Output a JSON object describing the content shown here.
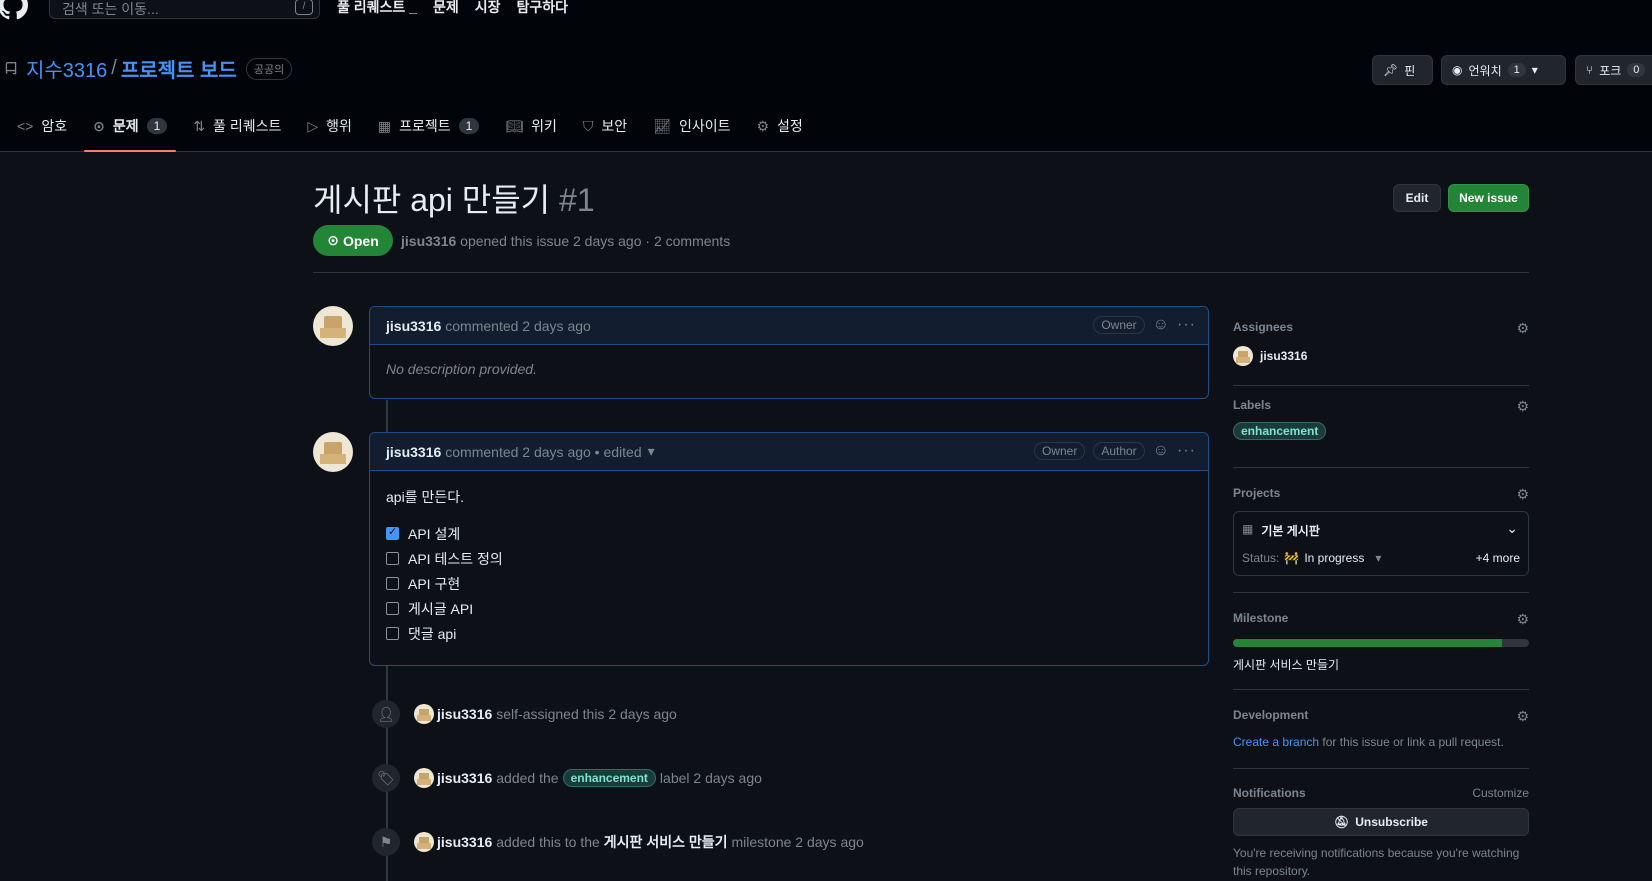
{
  "topbar": {
    "search_placeholder": "검색 또는 이동...",
    "search_key": "/",
    "nav": [
      "풀 리퀘스트 _",
      "문제",
      "시장",
      "탐구하다"
    ]
  },
  "repo": {
    "owner": "지수3316",
    "separator": "/",
    "name": "프로젝트 보드",
    "visibility": "공공의",
    "pin_label": "핀",
    "watch_label": "언워치",
    "watch_count": "1",
    "fork_label": "포크",
    "fork_count": "0"
  },
  "tabs": [
    {
      "label": "암호"
    },
    {
      "label": "문제",
      "count": "1"
    },
    {
      "label": "풀 리퀘스트"
    },
    {
      "label": "행위"
    },
    {
      "label": "프로젝트",
      "count": "1"
    },
    {
      "label": "위키"
    },
    {
      "label": "보안"
    },
    {
      "label": "인사이트"
    },
    {
      "label": "설정"
    }
  ],
  "issue": {
    "title": "게시판 api 만들기",
    "number": "#1",
    "state": "Open",
    "author": "jisu3316",
    "meta_text": "opened this issue 2 days ago · 2 comments",
    "edit_label": "Edit",
    "new_label": "New issue"
  },
  "comments": [
    {
      "author": "jisu3316",
      "meta": "commented 2 days ago",
      "badges": [
        "Owner"
      ],
      "body": "No description provided."
    },
    {
      "author": "jisu3316",
      "meta": "commented 2 days ago • edited",
      "badges": [
        "Owner",
        "Author"
      ],
      "body": "api를 만든다.",
      "tasks": [
        {
          "text": "API 설계",
          "checked": true
        },
        {
          "text": "API 테스트 정의",
          "checked": false
        },
        {
          "text": "API 구현",
          "checked": false
        },
        {
          "text": "게시글 API",
          "checked": false
        },
        {
          "text": "댓글 api",
          "checked": false
        }
      ]
    }
  ],
  "events": [
    {
      "author": "jisu3316",
      "text": "self-assigned this 2 days ago"
    },
    {
      "author": "jisu3316",
      "pre": "added the",
      "label": "enhancement",
      "post": "label 2 days ago"
    },
    {
      "author": "jisu3316",
      "pre": "added this to the",
      "milestone": "게시판 서비스 만들기",
      "post": "milestone 2 days ago"
    }
  ],
  "sidebar": {
    "assignees_title": "Assignees",
    "assignee": "jisu3316",
    "labels_title": "Labels",
    "label": "enhancement",
    "projects_title": "Projects",
    "project_name": "기본 게시판",
    "status_label": "Status:",
    "status_value": "In progress",
    "more": "+4 more",
    "milestone_title": "Milestone",
    "milestone_progress": 0.91,
    "milestone_name": "게시판 서비스 만들기",
    "development_title": "Development",
    "dev_link": "Create a branch",
    "dev_text": "for this issue or link a pull request.",
    "notifications_title": "Notifications",
    "customize": "Customize",
    "unsubscribe": "Unsubscribe",
    "notif_text": "You're receiving notifications because you're watching this repository."
  },
  "colors": {
    "accent_blue": "#4493f8",
    "open_green": "#238636",
    "active_tab": "#f78166"
  }
}
